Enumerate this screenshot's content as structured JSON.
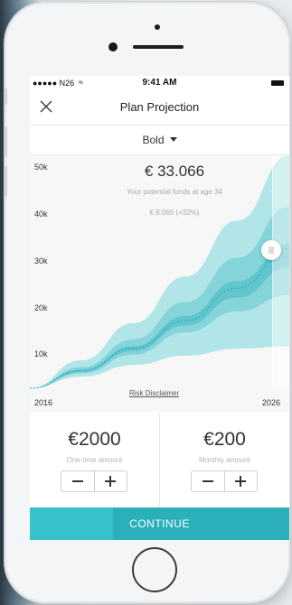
{
  "status_bar": {
    "carrier": "●●●●● N26",
    "time": "9:41 AM"
  },
  "nav": {
    "title": "Plan Projection"
  },
  "selector": {
    "label": "Bold"
  },
  "chart": {
    "amount": "€ 33.066",
    "subtitle": "Your potential funds at age 34",
    "gain": "€ 8.065 (+32%)",
    "disclaimer": "Risk Disclaimer",
    "colors": {
      "band_outer": "#a8e2e6",
      "band_mid": "#7fd2d8",
      "band_inner": "#5cc3ca",
      "median": "#2eaab3"
    }
  },
  "chart_data": {
    "type": "area",
    "x_start": "2016",
    "x_end": "2026",
    "y_ticks": [
      "50k",
      "40k",
      "30k",
      "20k",
      "10k"
    ],
    "ylim": [
      0,
      50000
    ],
    "x": [
      2016,
      2018,
      2020,
      2022,
      2024,
      2026
    ],
    "series": [
      {
        "values_upper": [
          0,
          6000,
          14000,
          24000,
          36000,
          50000
        ],
        "values_lower": [
          0,
          2500,
          5000,
          7000,
          8500,
          9000
        ]
      },
      {
        "values_upper": [
          0,
          4500,
          10500,
          18500,
          28000,
          39000
        ],
        "values_lower": [
          0,
          3200,
          7200,
          12000,
          16500,
          20000
        ]
      },
      {
        "values_upper": [
          0,
          4000,
          9000,
          15500,
          23000,
          31000
        ],
        "values_lower": [
          0,
          3500,
          8000,
          13500,
          19500,
          26000
        ]
      }
    ],
    "median": [
      0,
      3800,
      8600,
      14500,
      21500,
      30000
    ],
    "selected_year": 2026,
    "selected_value": 33066
  },
  "one_time": {
    "value": "€2000",
    "caption": "One-time amount"
  },
  "monthly": {
    "value": "€200",
    "caption": "Monthly amount"
  },
  "cta": {
    "label": "CONTINUE"
  }
}
